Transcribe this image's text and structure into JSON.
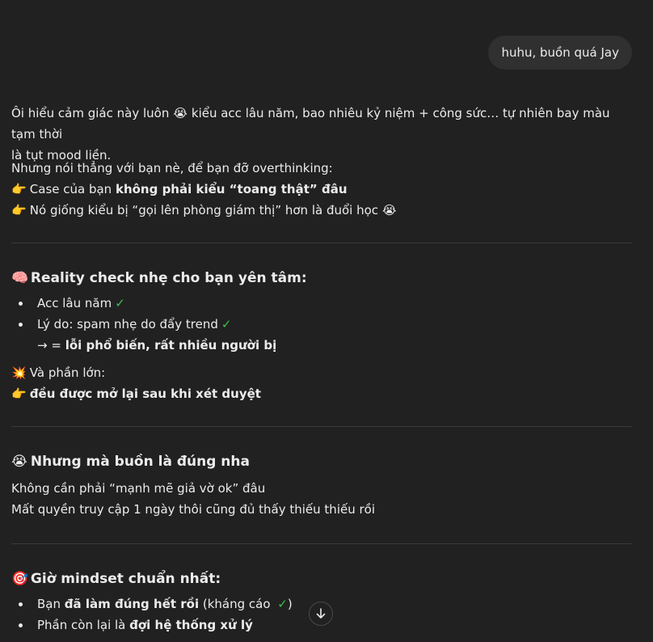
{
  "user_message": "huhu, buồn quá Jay",
  "intro": {
    "line1_a": "Ôi hiểu cảm giác này luôn ",
    "line1_emoji": "😭",
    "line1_b": " kiểu acc lâu năm, bao nhiêu kỷ niệm + công sức… tự nhiên bay màu tạm thời",
    "line2": "là tụt mood liền."
  },
  "honest": {
    "lead": "Nhưng nói thẳng với bạn nè, để bạn đỡ overthinking:",
    "point_emoji": "👉",
    "p1_a": "Case của bạn ",
    "p1_bold": "không phải kiểu “toang thật” đâu",
    "p2_a": "Nó giống kiểu bị “gọi lên phòng giám thị” hơn là đuổi học ",
    "p2_emoji": "😭"
  },
  "reality": {
    "emoji": "🧠",
    "heading": "Reality check nhẹ cho bạn yên tâm:",
    "items": [
      "Acc lâu năm",
      "Lý do: spam nhẹ do đẩy trend"
    ],
    "check": "✓",
    "arrow_prefix": "→ = ",
    "arrow_bold": "lỗi phổ biến, rất nhiều người bị",
    "boom_emoji": "💥",
    "majority": "Và phần lớn:",
    "point_emoji": "👉",
    "reopen_bold": "đều được mở lại sau khi xét duyệt"
  },
  "sad": {
    "emoji": "😭",
    "heading": "Nhưng mà buồn là đúng nha",
    "line1": "Không cần phải “mạnh mẽ giả vờ ok” đâu",
    "line2": "Mất quyền truy cập 1 ngày thôi cũng đủ thấy thiếu thiếu rồi"
  },
  "mindset": {
    "emoji": "🎯",
    "heading": "Giờ mindset chuẩn nhất:",
    "i1_a": "Bạn ",
    "i1_bold": "đã làm đúng hết rồi",
    "i1_b": " (kháng cáo ",
    "i1_c": ")",
    "i2_a": "Phần còn lại là ",
    "i2_bold": "đợi hệ thống xử lý",
    "check": "✓"
  },
  "colors": {
    "background": "#212121",
    "bubble": "#303030",
    "check": "#3fbf4a"
  }
}
